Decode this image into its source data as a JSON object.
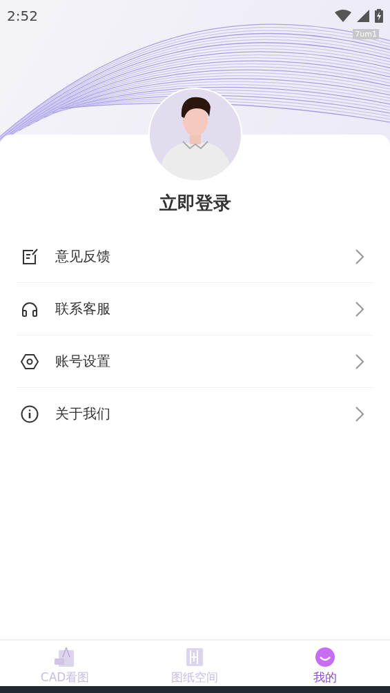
{
  "status_bar": {
    "time": "2:52",
    "badge": "7um1"
  },
  "profile": {
    "login": "立即登录"
  },
  "menu": [
    {
      "kind": "feedback",
      "label": "意见反馈"
    },
    {
      "kind": "service",
      "label": "联系客服"
    },
    {
      "kind": "settings",
      "label": "账号设置"
    },
    {
      "kind": "about",
      "label": "关于我们"
    }
  ],
  "tabs": [
    {
      "kind": "viewer",
      "label": "CAD看图",
      "selected": false
    },
    {
      "kind": "drawings",
      "label": "图纸空间",
      "selected": false
    },
    {
      "kind": "me",
      "label": "我的",
      "selected": true
    }
  ]
}
